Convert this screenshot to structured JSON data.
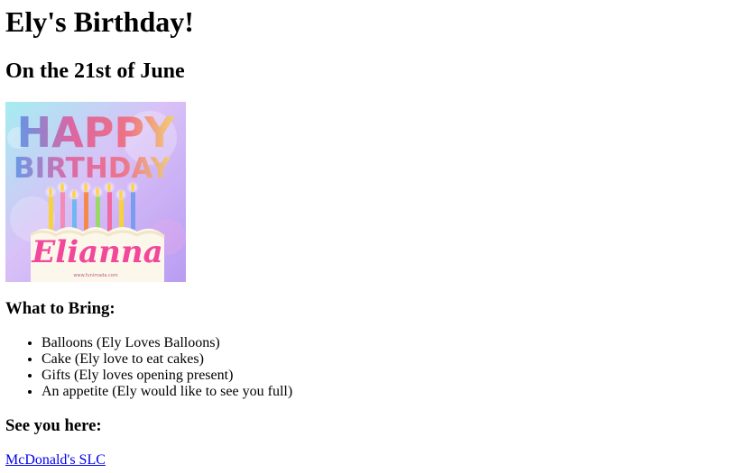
{
  "heading": {
    "title": "Ely's Birthday!",
    "date": "On the 21st of June"
  },
  "banner": {
    "line1": "HAPPY",
    "line2": "BIRTHDAY",
    "name": "Elianna",
    "watermark": "www.funimada.com",
    "colors": {
      "bg_top": "#b9e7f7",
      "bg_bottom": "#c9b4f6",
      "name": "#f2479b",
      "cake": "#fbf7ea"
    }
  },
  "bring": {
    "heading": "What to Bring:",
    "items": [
      "Balloons (Ely Loves Balloons)",
      "Cake (Ely love to eat cakes)",
      "Gifts (Ely loves opening present)",
      "An appetite (Ely would like to see you full)"
    ]
  },
  "location": {
    "heading": "See you here:",
    "link_text": "McDonald's SLC"
  }
}
